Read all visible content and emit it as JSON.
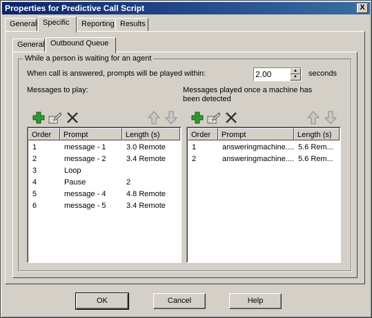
{
  "window": {
    "title": "Properties for Predictive Call Script",
    "close_label": "X"
  },
  "tabs": [
    "General",
    "Specific",
    "Reporting",
    "Results"
  ],
  "subtabs": [
    "General",
    "Outbound Queue"
  ],
  "group": {
    "legend": "While a person is waiting for an agent",
    "prompt_label": "When call is answered, prompts will be played within:",
    "prompt_value": "2.00",
    "prompt_unit": "seconds",
    "left_label": "Messages to play:",
    "right_label_line1": "Messages played once a machine has",
    "right_label_line2": "been detected"
  },
  "icons": [
    "add-icon",
    "edit-icon",
    "delete-icon",
    "move-up-icon",
    "move-down-icon"
  ],
  "left_list": {
    "columns": [
      "Order",
      "Prompt",
      "Length (s)"
    ],
    "rows": [
      [
        "1",
        "message - 1",
        "3.0 Remote"
      ],
      [
        "2",
        "message - 2",
        "3.4 Remote"
      ],
      [
        "3",
        "Loop",
        ""
      ],
      [
        "4",
        "Pause",
        "2"
      ],
      [
        "5",
        "message - 4",
        "4.8 Remote"
      ],
      [
        "6",
        "message - 5",
        "3.4 Remote"
      ]
    ]
  },
  "right_list": {
    "columns": [
      "Order",
      "Prompt",
      "Length (s)"
    ],
    "rows": [
      [
        "1",
        "answeringmachine....",
        "5.6 Rem..."
      ],
      [
        "2",
        "answeringmachine....",
        "5.6 Rem..."
      ]
    ]
  },
  "buttons": {
    "ok": "OK",
    "cancel": "Cancel",
    "help": "Help"
  },
  "colors": {
    "titlebar": "#0a246a",
    "face": "#d4d0c8",
    "plus": "#2e9a2e",
    "arrow": "#a0a0a0"
  }
}
